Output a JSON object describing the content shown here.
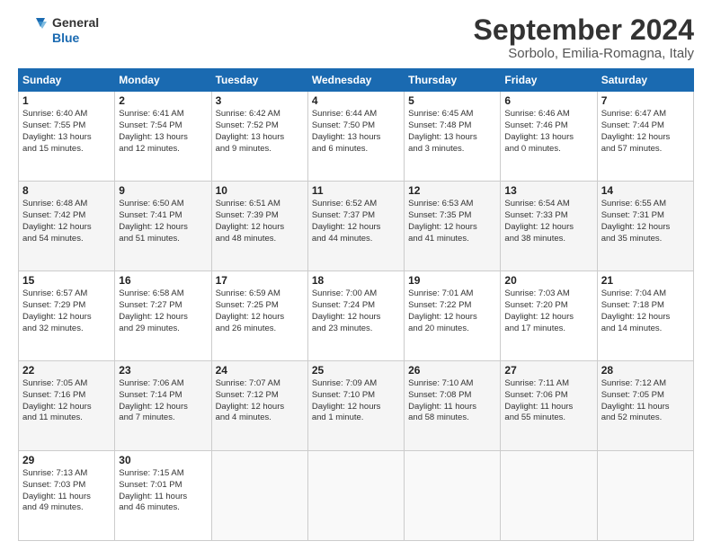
{
  "header": {
    "logo_line1": "General",
    "logo_line2": "Blue",
    "title": "September 2024",
    "subtitle": "Sorbolo, Emilia-Romagna, Italy"
  },
  "columns": [
    "Sunday",
    "Monday",
    "Tuesday",
    "Wednesday",
    "Thursday",
    "Friday",
    "Saturday"
  ],
  "weeks": [
    [
      {
        "day": "1",
        "info": "Sunrise: 6:40 AM\nSunset: 7:55 PM\nDaylight: 13 hours\nand 15 minutes."
      },
      {
        "day": "2",
        "info": "Sunrise: 6:41 AM\nSunset: 7:54 PM\nDaylight: 13 hours\nand 12 minutes."
      },
      {
        "day": "3",
        "info": "Sunrise: 6:42 AM\nSunset: 7:52 PM\nDaylight: 13 hours\nand 9 minutes."
      },
      {
        "day": "4",
        "info": "Sunrise: 6:44 AM\nSunset: 7:50 PM\nDaylight: 13 hours\nand 6 minutes."
      },
      {
        "day": "5",
        "info": "Sunrise: 6:45 AM\nSunset: 7:48 PM\nDaylight: 13 hours\nand 3 minutes."
      },
      {
        "day": "6",
        "info": "Sunrise: 6:46 AM\nSunset: 7:46 PM\nDaylight: 13 hours\nand 0 minutes."
      },
      {
        "day": "7",
        "info": "Sunrise: 6:47 AM\nSunset: 7:44 PM\nDaylight: 12 hours\nand 57 minutes."
      }
    ],
    [
      {
        "day": "8",
        "info": "Sunrise: 6:48 AM\nSunset: 7:42 PM\nDaylight: 12 hours\nand 54 minutes."
      },
      {
        "day": "9",
        "info": "Sunrise: 6:50 AM\nSunset: 7:41 PM\nDaylight: 12 hours\nand 51 minutes."
      },
      {
        "day": "10",
        "info": "Sunrise: 6:51 AM\nSunset: 7:39 PM\nDaylight: 12 hours\nand 48 minutes."
      },
      {
        "day": "11",
        "info": "Sunrise: 6:52 AM\nSunset: 7:37 PM\nDaylight: 12 hours\nand 44 minutes."
      },
      {
        "day": "12",
        "info": "Sunrise: 6:53 AM\nSunset: 7:35 PM\nDaylight: 12 hours\nand 41 minutes."
      },
      {
        "day": "13",
        "info": "Sunrise: 6:54 AM\nSunset: 7:33 PM\nDaylight: 12 hours\nand 38 minutes."
      },
      {
        "day": "14",
        "info": "Sunrise: 6:55 AM\nSunset: 7:31 PM\nDaylight: 12 hours\nand 35 minutes."
      }
    ],
    [
      {
        "day": "15",
        "info": "Sunrise: 6:57 AM\nSunset: 7:29 PM\nDaylight: 12 hours\nand 32 minutes."
      },
      {
        "day": "16",
        "info": "Sunrise: 6:58 AM\nSunset: 7:27 PM\nDaylight: 12 hours\nand 29 minutes."
      },
      {
        "day": "17",
        "info": "Sunrise: 6:59 AM\nSunset: 7:25 PM\nDaylight: 12 hours\nand 26 minutes."
      },
      {
        "day": "18",
        "info": "Sunrise: 7:00 AM\nSunset: 7:24 PM\nDaylight: 12 hours\nand 23 minutes."
      },
      {
        "day": "19",
        "info": "Sunrise: 7:01 AM\nSunset: 7:22 PM\nDaylight: 12 hours\nand 20 minutes."
      },
      {
        "day": "20",
        "info": "Sunrise: 7:03 AM\nSunset: 7:20 PM\nDaylight: 12 hours\nand 17 minutes."
      },
      {
        "day": "21",
        "info": "Sunrise: 7:04 AM\nSunset: 7:18 PM\nDaylight: 12 hours\nand 14 minutes."
      }
    ],
    [
      {
        "day": "22",
        "info": "Sunrise: 7:05 AM\nSunset: 7:16 PM\nDaylight: 12 hours\nand 11 minutes."
      },
      {
        "day": "23",
        "info": "Sunrise: 7:06 AM\nSunset: 7:14 PM\nDaylight: 12 hours\nand 7 minutes."
      },
      {
        "day": "24",
        "info": "Sunrise: 7:07 AM\nSunset: 7:12 PM\nDaylight: 12 hours\nand 4 minutes."
      },
      {
        "day": "25",
        "info": "Sunrise: 7:09 AM\nSunset: 7:10 PM\nDaylight: 12 hours\nand 1 minute."
      },
      {
        "day": "26",
        "info": "Sunrise: 7:10 AM\nSunset: 7:08 PM\nDaylight: 11 hours\nand 58 minutes."
      },
      {
        "day": "27",
        "info": "Sunrise: 7:11 AM\nSunset: 7:06 PM\nDaylight: 11 hours\nand 55 minutes."
      },
      {
        "day": "28",
        "info": "Sunrise: 7:12 AM\nSunset: 7:05 PM\nDaylight: 11 hours\nand 52 minutes."
      }
    ],
    [
      {
        "day": "29",
        "info": "Sunrise: 7:13 AM\nSunset: 7:03 PM\nDaylight: 11 hours\nand 49 minutes."
      },
      {
        "day": "30",
        "info": "Sunrise: 7:15 AM\nSunset: 7:01 PM\nDaylight: 11 hours\nand 46 minutes."
      },
      {
        "day": "",
        "info": ""
      },
      {
        "day": "",
        "info": ""
      },
      {
        "day": "",
        "info": ""
      },
      {
        "day": "",
        "info": ""
      },
      {
        "day": "",
        "info": ""
      }
    ]
  ]
}
